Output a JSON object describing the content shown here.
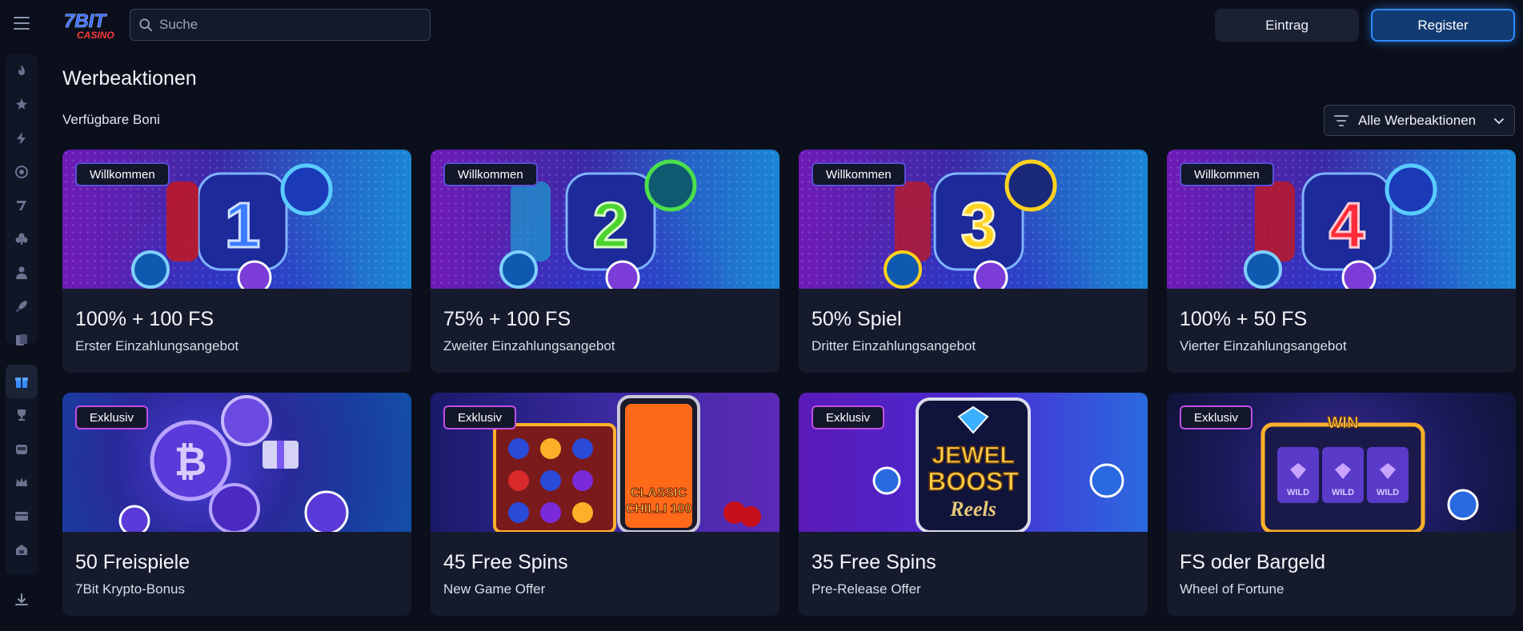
{
  "brand": {
    "logo_text": "7BIT",
    "logo_sub": "CASINO"
  },
  "search": {
    "placeholder": "Suche"
  },
  "header": {
    "login_label": "Eintrag",
    "register_label": "Register"
  },
  "page": {
    "title": "Werbeaktionen",
    "section_label": "Verfügbare Boni"
  },
  "filter": {
    "label": "Alle Werbeaktionen"
  },
  "sidebar": {
    "items": [
      {
        "icon": "fire-icon"
      },
      {
        "icon": "star-burst-icon"
      },
      {
        "icon": "lightning-icon"
      },
      {
        "icon": "target-icon"
      },
      {
        "icon": "seven-icon"
      },
      {
        "icon": "clubs-icon"
      },
      {
        "icon": "dealer-icon"
      },
      {
        "icon": "rocket-icon"
      },
      {
        "icon": "cards-icon"
      }
    ],
    "items2": [
      {
        "icon": "gift-icon",
        "active": true
      },
      {
        "icon": "trophy-icon"
      },
      {
        "icon": "slot-machine-icon"
      },
      {
        "icon": "crown-icon"
      },
      {
        "icon": "wallet-icon"
      },
      {
        "icon": "vault-icon"
      }
    ]
  },
  "cards": [
    {
      "badge": "Willkommen",
      "title": "100% + 100 FS",
      "subtitle": "Erster Einzahlungsangebot",
      "number": "1",
      "number_color": "#3a7bff"
    },
    {
      "badge": "Willkommen",
      "title": "75% + 100 FS",
      "subtitle": "Zweiter Einzahlungsangebot",
      "number": "2",
      "number_color": "#4bd42e"
    },
    {
      "badge": "Willkommen",
      "title": "50% Spiel",
      "subtitle": "Dritter Einzahlungsangebot",
      "number": "3",
      "number_color": "#ffd21e"
    },
    {
      "badge": "Willkommen",
      "title": "100% + 50 FS",
      "subtitle": "Vierter Einzahlungsangebot",
      "number": "4",
      "number_color": "#ff2a3a"
    },
    {
      "badge": "Exklusiv",
      "title": "50 Freispiele",
      "subtitle": "7Bit Krypto-Bonus"
    },
    {
      "badge": "Exklusiv",
      "title": "45 Free Spins",
      "subtitle": "New Game Offer",
      "art_text_1": "CLASSIC",
      "art_text_2": "CHILLI 100"
    },
    {
      "badge": "Exklusiv",
      "title": "35 Free Spins",
      "subtitle": "Pre-Release Offer",
      "art_text_1": "JEWEL",
      "art_text_2": "BOOST",
      "art_text_3": "Reels"
    },
    {
      "badge": "Exklusiv",
      "title": "FS oder Bargeld",
      "subtitle": "Wheel of Fortune",
      "art_text_1": "WIN",
      "art_text_2": "WILD"
    }
  ]
}
